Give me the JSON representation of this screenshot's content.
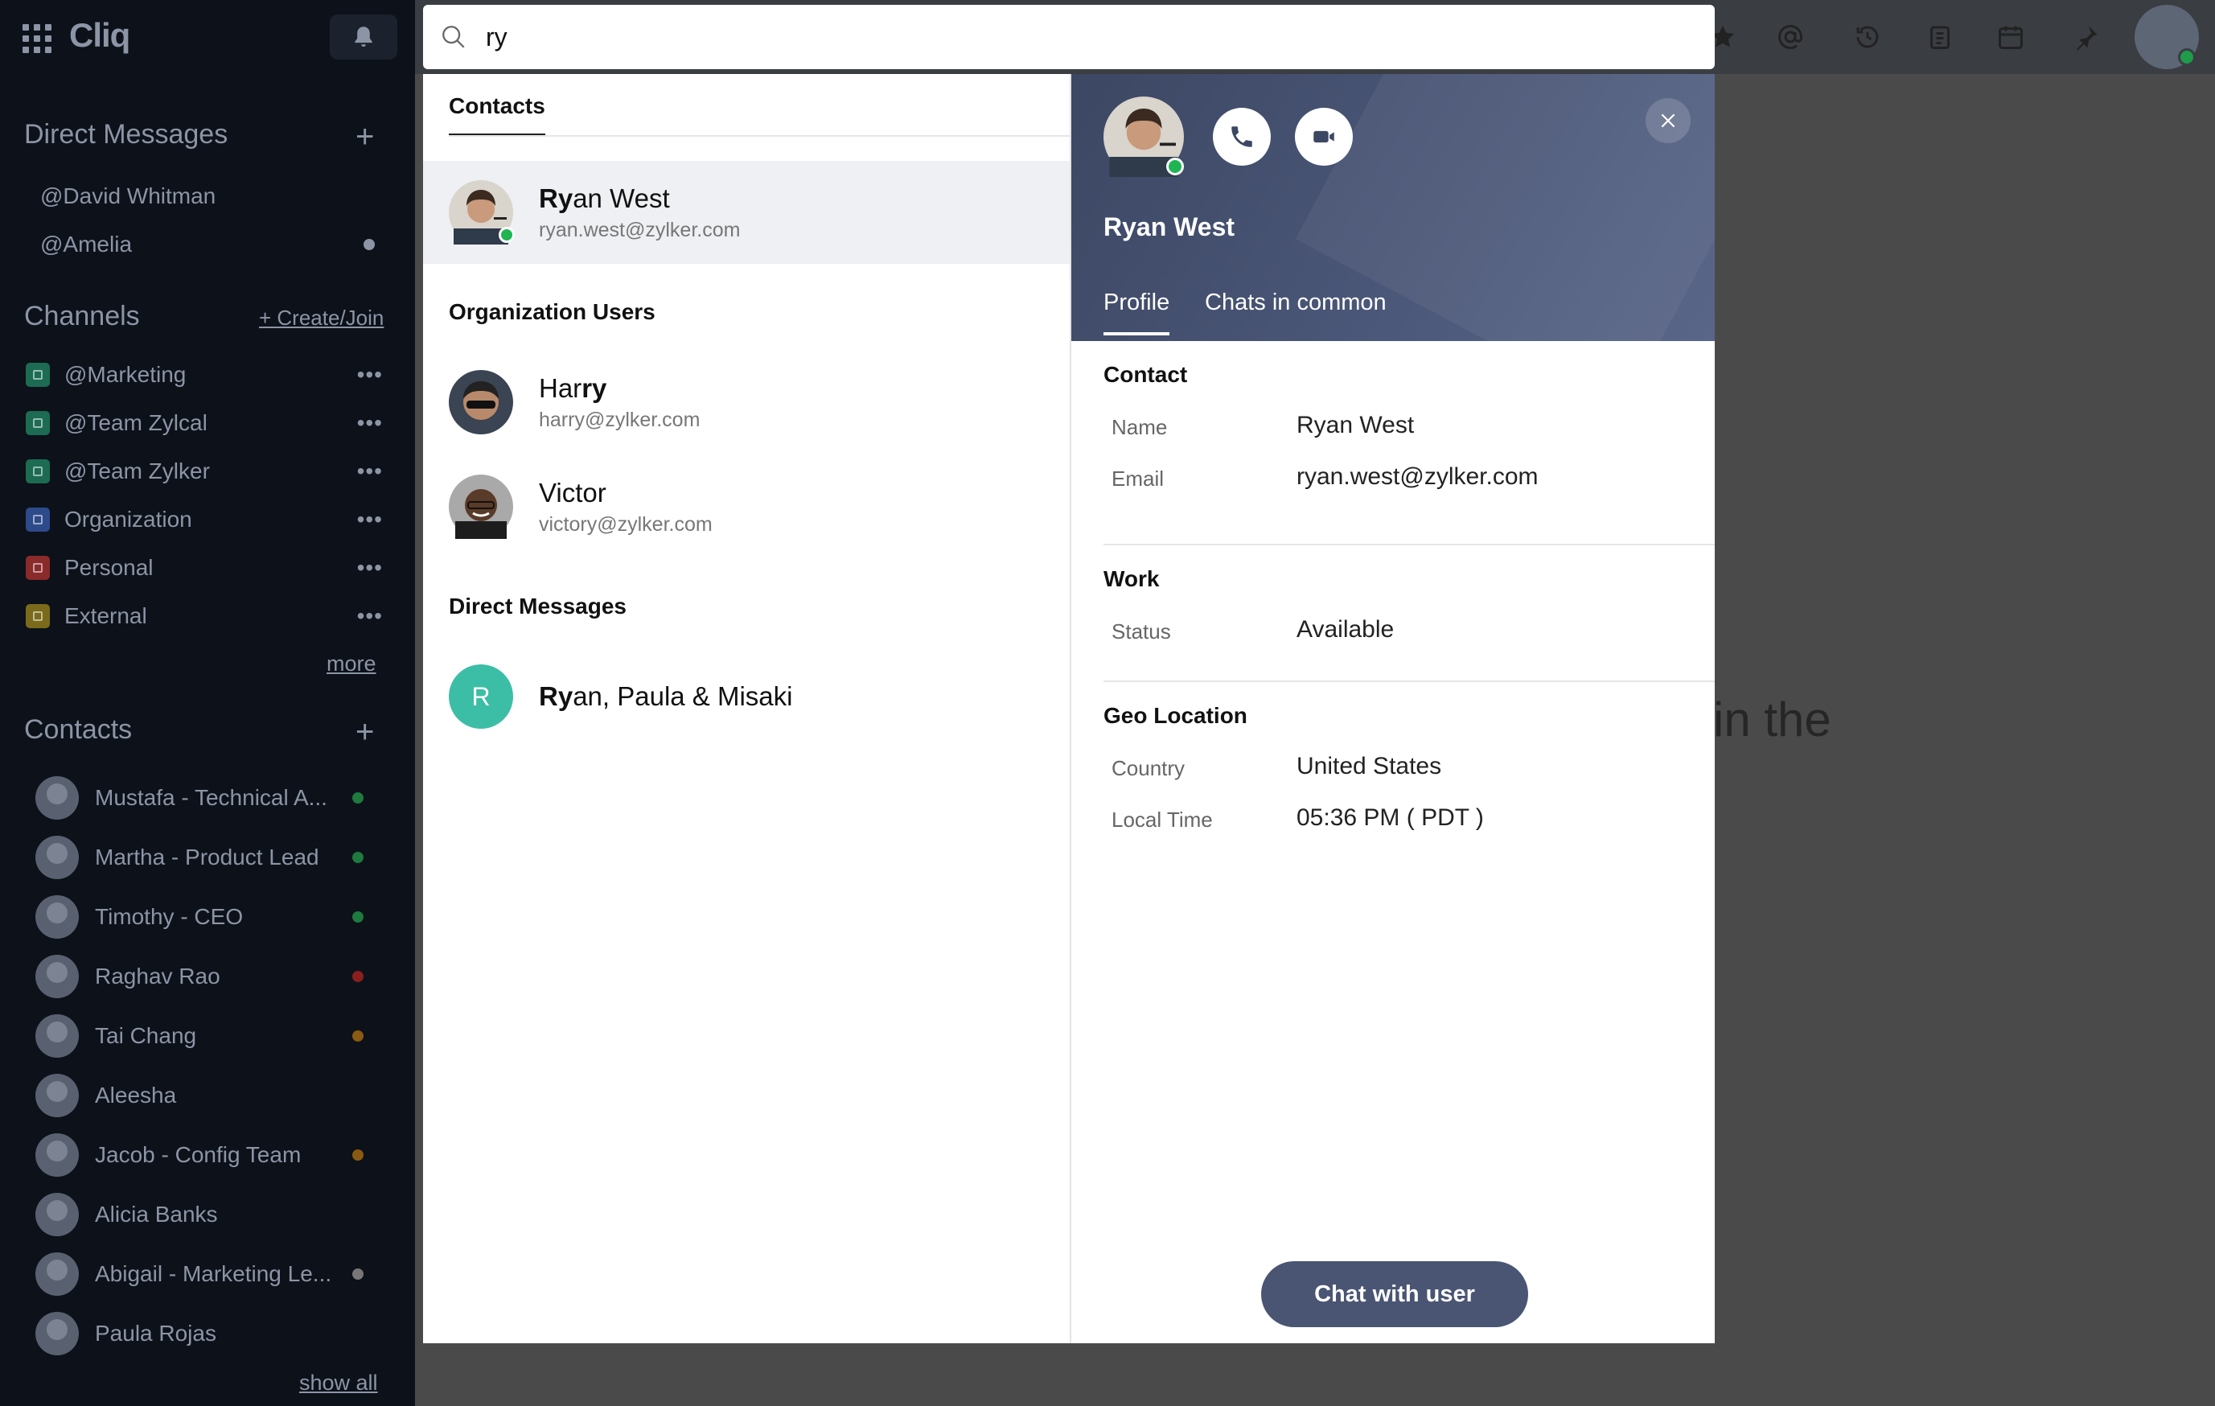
{
  "sidebar": {
    "app_name": "Cliq",
    "direct_messages_title": "Direct Messages",
    "direct_messages": [
      {
        "label": "@David Whitman"
      },
      {
        "label": "@Amelia"
      }
    ],
    "channels_title": "Channels",
    "create_join_label": "+ Create/Join",
    "channels": [
      {
        "label": "@Marketing",
        "color": "#1c6b52"
      },
      {
        "label": "@Team Zylcal",
        "color": "#1c6b52"
      },
      {
        "label": "@Team Zylker",
        "color": "#1c6b52"
      },
      {
        "label": "Organization",
        "color": "#2d4a8a"
      },
      {
        "label": "Personal",
        "color": "#8a2a2a"
      },
      {
        "label": "External",
        "color": "#7a6a1a"
      }
    ],
    "channel_more": "•••",
    "more_label": "more",
    "contacts_title": "Contacts",
    "contacts": [
      {
        "label": "Mustafa - Technical A...",
        "status_color": "#1e7a3e"
      },
      {
        "label": "Martha -  Product Lead",
        "status_color": "#1e7a3e"
      },
      {
        "label": "Timothy - CEO",
        "status_color": "#1e7a3e"
      },
      {
        "label": "Raghav Rao",
        "status_color": "#8a1f1f"
      },
      {
        "label": "Tai Chang",
        "status_color": "#8a5a12"
      },
      {
        "label": "Aleesha",
        "status_color": ""
      },
      {
        "label": "Jacob - Config Team",
        "status_color": "#8a5a12"
      },
      {
        "label": "Alicia Banks",
        "status_color": ""
      },
      {
        "label": "Abigail - Marketing Le...",
        "status_color": "#777777"
      },
      {
        "label": "Paula Rojas",
        "status_color": ""
      }
    ],
    "show_all_label": "show all"
  },
  "background_text": "in the",
  "search": {
    "query": "ry"
  },
  "results": {
    "tab_label": "Contacts",
    "contacts": [
      {
        "name_match": "Ry",
        "name_rest": "an West",
        "email": "ryan.west@zylker.com"
      }
    ],
    "org_users_title": "Organization Users",
    "org_users": [
      {
        "name_before": "Har",
        "name_match": "ry",
        "email": "harry@zylker.com"
      },
      {
        "name": "Victor",
        "email": "victory@zylker.com"
      }
    ],
    "direct_messages_title": "Direct Messages",
    "direct_messages": [
      {
        "initial": "R",
        "name_match": "Ry",
        "name_rest": "an, Paula & Misaki"
      }
    ]
  },
  "profile": {
    "name": "Ryan West",
    "tabs": [
      "Profile",
      "Chats in common"
    ],
    "contact_title": "Contact",
    "name_key": "Name",
    "name_value": "Ryan West",
    "email_key": "Email",
    "email_value": "ryan.west@zylker.com",
    "work_title": "Work",
    "status_key": "Status",
    "status_value": "Available",
    "geo_title": "Geo Location",
    "country_key": "Country",
    "country_value": "United States",
    "local_time_key": "Local Time",
    "local_time_value": "05:36 PM ( PDT )",
    "chat_button": "Chat with user"
  }
}
